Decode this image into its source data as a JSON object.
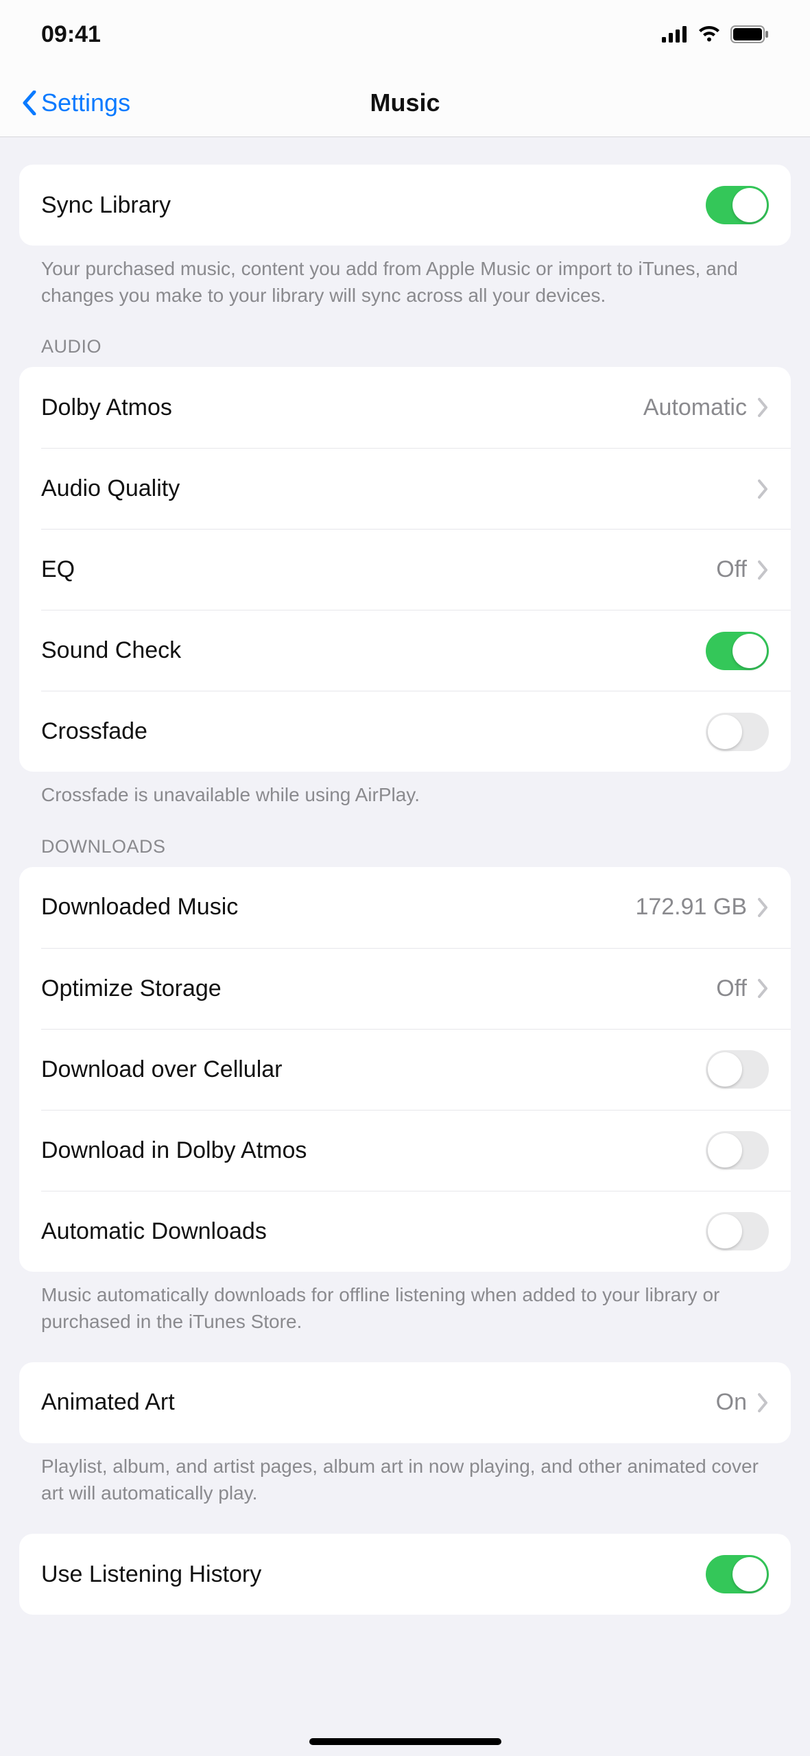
{
  "status": {
    "time": "09:41"
  },
  "nav": {
    "back_label": "Settings",
    "title": "Music"
  },
  "sync_section": {
    "items": [
      {
        "label": "Sync Library",
        "type": "toggle",
        "on": true
      }
    ],
    "footer": "Your purchased music, content you add from Apple Music or import to iTunes, and changes you make to your library will sync across all your devices."
  },
  "audio_section": {
    "header": "AUDIO",
    "items": [
      {
        "label": "Dolby Atmos",
        "type": "link",
        "detail": "Automatic"
      },
      {
        "label": "Audio Quality",
        "type": "link",
        "detail": ""
      },
      {
        "label": "EQ",
        "type": "link",
        "detail": "Off"
      },
      {
        "label": "Sound Check",
        "type": "toggle",
        "on": true
      },
      {
        "label": "Crossfade",
        "type": "toggle",
        "on": false
      }
    ],
    "footer": "Crossfade is unavailable while using AirPlay."
  },
  "downloads_section": {
    "header": "DOWNLOADS",
    "items": [
      {
        "label": "Downloaded Music",
        "type": "link",
        "detail": "172.91 GB"
      },
      {
        "label": "Optimize Storage",
        "type": "link",
        "detail": "Off"
      },
      {
        "label": "Download over Cellular",
        "type": "toggle",
        "on": false
      },
      {
        "label": "Download in Dolby Atmos",
        "type": "toggle",
        "on": false
      },
      {
        "label": "Automatic Downloads",
        "type": "toggle",
        "on": false
      }
    ],
    "footer": "Music automatically downloads for offline listening when added to your library or purchased in the iTunes Store."
  },
  "animated_art_section": {
    "items": [
      {
        "label": "Animated Art",
        "type": "link",
        "detail": "On"
      }
    ],
    "footer": "Playlist, album, and artist pages, album art in now playing, and other animated cover art will automatically play."
  },
  "listening_section": {
    "items": [
      {
        "label": "Use Listening History",
        "type": "toggle",
        "on": true
      }
    ]
  }
}
